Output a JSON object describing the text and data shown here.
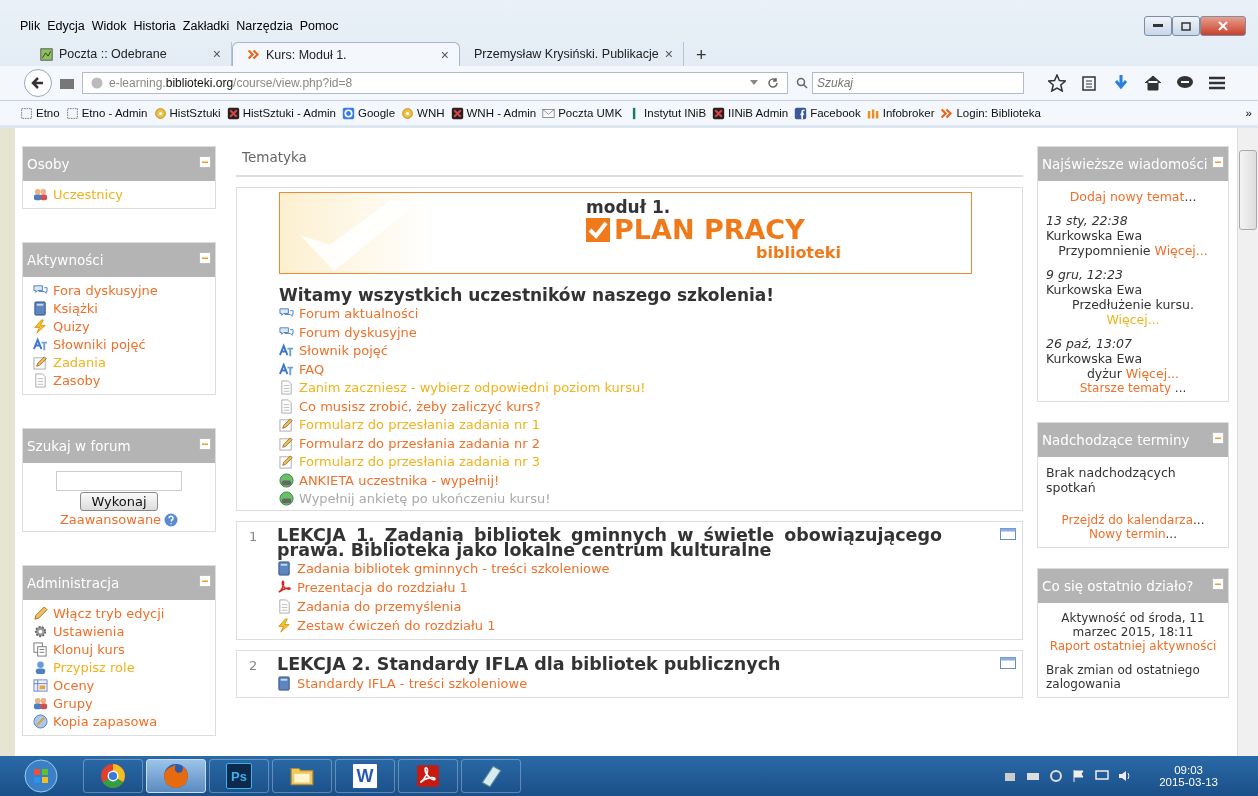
{
  "menu": [
    "Plik",
    "Edycja",
    "Widok",
    "Historia",
    "Zakładki",
    "Narzędzia",
    "Pomoc"
  ],
  "tabs": [
    {
      "label": "Poczta :: Odebrane",
      "kind": "map",
      "selected": false,
      "close": "×"
    },
    {
      "label": "Kurs: Moduł 1.",
      "kind": "chevrons",
      "selected": true,
      "close": "×"
    },
    {
      "label": "Przemysław Krysiński. Publikacje",
      "kind": "plain",
      "selected": false,
      "close": "×"
    }
  ],
  "new_tab": "+",
  "url": {
    "prefix": "e-learning.",
    "domain": "biblioteki.org",
    "path": "/course/view.php?id=8"
  },
  "search": {
    "placeholder": "Szukaj"
  },
  "bookmarks": [
    {
      "label": "Etno",
      "kind": "folder"
    },
    {
      "label": "Etno - Admin",
      "kind": "folder"
    },
    {
      "label": "HistSztuki",
      "kind": "sun"
    },
    {
      "label": "HistSztuki - Admin",
      "kind": "cross"
    },
    {
      "label": "Google",
      "kind": "g"
    },
    {
      "label": "WNH",
      "kind": "sun"
    },
    {
      "label": "WNH - Admin",
      "kind": "cross"
    },
    {
      "label": "Poczta UMK",
      "kind": "mail"
    },
    {
      "label": "Instytut INiB",
      "kind": "bar"
    },
    {
      "label": "IINiB Admin",
      "kind": "cross"
    },
    {
      "label": "Facebook",
      "kind": "f"
    },
    {
      "label": "Infobroker",
      "kind": "m"
    },
    {
      "label": "Login: Biblioteka",
      "kind": "chevrons"
    }
  ],
  "bookmarks_more": "»",
  "left_blocks": [
    {
      "title": "Osoby",
      "kind": "links",
      "items": [
        {
          "label": "Uczestnicy",
          "kind": "people",
          "visited": true
        }
      ]
    },
    {
      "title": "Aktywności",
      "kind": "links",
      "items": [
        {
          "label": "Fora dyskusyjne",
          "kind": "forum",
          "visited": false
        },
        {
          "label": "Książki",
          "kind": "book",
          "visited": false
        },
        {
          "label": "Quizy",
          "kind": "quiz",
          "visited": false
        },
        {
          "label": "Słowniki pojęć",
          "kind": "glossary",
          "visited": false
        },
        {
          "label": "Zadania",
          "kind": "assignment",
          "visited": true
        },
        {
          "label": "Zasoby",
          "kind": "resource",
          "visited": false
        }
      ]
    },
    {
      "title": "Szukaj w forum",
      "kind": "search",
      "button": "Wykonaj",
      "advanced": "Zaawansowane"
    },
    {
      "title": "Administracja",
      "kind": "links",
      "items": [
        {
          "label": "Włącz tryb edycji",
          "kind": "pencil",
          "visited": false
        },
        {
          "label": "Ustawienia",
          "kind": "gear",
          "visited": false
        },
        {
          "label": "Klonuj kurs",
          "kind": "clone",
          "visited": false
        },
        {
          "label": "Przypisz role",
          "kind": "user",
          "visited": true
        },
        {
          "label": "Oceny",
          "kind": "grades",
          "visited": false
        },
        {
          "label": "Grupy",
          "kind": "groups",
          "visited": false
        },
        {
          "label": "Kopia zapasowa",
          "kind": "backup",
          "visited": false
        }
      ]
    }
  ],
  "topic_header": "Tematyka",
  "banner": {
    "line1": "moduł 1.",
    "line2": "PLAN PRACY",
    "line3": "biblioteki"
  },
  "welcome": "Witamy wszystkich uczestników naszego szkolenia!",
  "intro_items": [
    {
      "label": "Forum aktualności",
      "kind": "forum",
      "visited": false,
      "dimmed": false
    },
    {
      "label": "Forum dyskusyjne",
      "kind": "forum",
      "visited": false,
      "dimmed": false
    },
    {
      "label": "Słownik pojęć",
      "kind": "glossary",
      "visited": false,
      "dimmed": false
    },
    {
      "label": "FAQ",
      "kind": "glossary",
      "visited": false,
      "dimmed": false
    },
    {
      "label": "Zanim zaczniesz - wybierz odpowiedni poziom kursu!",
      "kind": "resource",
      "visited": true,
      "dimmed": false
    },
    {
      "label": "Co musisz zrobić, żeby zaliczyć kurs?",
      "kind": "resource",
      "visited": false,
      "dimmed": false
    },
    {
      "label": "Formularz do przesłania zadania nr 1",
      "kind": "assignment",
      "visited": true,
      "dimmed": false
    },
    {
      "label": "Formularz do przesłania zadania nr 2",
      "kind": "assignment",
      "visited": false,
      "dimmed": false
    },
    {
      "label": "Formularz do przesłania zadania nr 3",
      "kind": "assignment",
      "visited": true,
      "dimmed": false
    },
    {
      "label": "ANKIETA uczestnika - wypełnij!",
      "kind": "survey",
      "visited": false,
      "dimmed": false
    },
    {
      "label": "Wypełnij ankietę po ukończeniu kursu!",
      "kind": "survey",
      "visited": false,
      "dimmed": true
    }
  ],
  "lessons": [
    {
      "number": "1",
      "title": "LEKCJA 1. Zadania bibliotek gminnych w świetle obowiązującego prawa. Biblioteka jako lokalne centrum kulturalne",
      "items": [
        {
          "label": "Zadania bibliotek gminnych - treści szkoleniowe",
          "kind": "book",
          "visited": false
        },
        {
          "label": "Prezentacja do rozdziału 1",
          "kind": "pdf",
          "visited": false
        },
        {
          "label": "Zadania do przemyślenia",
          "kind": "resource",
          "visited": false
        },
        {
          "label": "Zestaw ćwiczeń do rozdziału 1",
          "kind": "quiz",
          "visited": false
        }
      ]
    },
    {
      "number": "2",
      "title": "LEKCJA 2. Standardy IFLA dla bibliotek publicznych",
      "items": [
        {
          "label": "Standardy IFLA - treści szkoleniowe",
          "kind": "book",
          "visited": false
        }
      ]
    }
  ],
  "news": {
    "title": "Najświeższe wiadomości",
    "add": {
      "label": "Dodaj nowy temat",
      "suffix": "..."
    },
    "posts": [
      {
        "date": "13 sty, 22:38",
        "author": "Kurkowska Ewa",
        "subject": "Przypomnienie",
        "more": "Więcej...",
        "visited": false
      },
      {
        "date": "9 gru, 12:23",
        "author": "Kurkowska Ewa",
        "subject": "Przedłużenie kursu.",
        "more": "Więcej...",
        "visited": true
      },
      {
        "date": "26 paź, 13:07",
        "author": "Kurkowska Ewa",
        "subject": "dyżur",
        "more": "Więcej...",
        "visited": false
      }
    ],
    "older": {
      "label": "Starsze tematy",
      "suffix": " ..."
    }
  },
  "upcoming": {
    "title": "Nadchodzące terminy",
    "text": "Brak nadchodzących spotkań",
    "links": [
      {
        "label": "Przejdź do kalendarza",
        "suffix": "..."
      },
      {
        "label": "Nowy termin",
        "suffix": "..."
      }
    ]
  },
  "recent": {
    "title": "Co się ostatnio działo?",
    "since": "Aktywność od środa, 11 marzec 2015, 18:11",
    "report": "Raport ostatniej aktywności",
    "none": "Brak zmian od ostatniego zalogowania"
  },
  "taskbar": {
    "apps": [
      {
        "kind": "chrome",
        "selected": false
      },
      {
        "kind": "firefox",
        "selected": true
      },
      {
        "kind": "ps",
        "label": "Ps",
        "selected": false
      },
      {
        "kind": "folder",
        "selected": false
      },
      {
        "kind": "word",
        "label": "W",
        "selected": false
      },
      {
        "kind": "pdf",
        "selected": false
      },
      {
        "kind": "notes",
        "selected": false
      }
    ],
    "time": "09:03",
    "date": "2015-03-13"
  }
}
